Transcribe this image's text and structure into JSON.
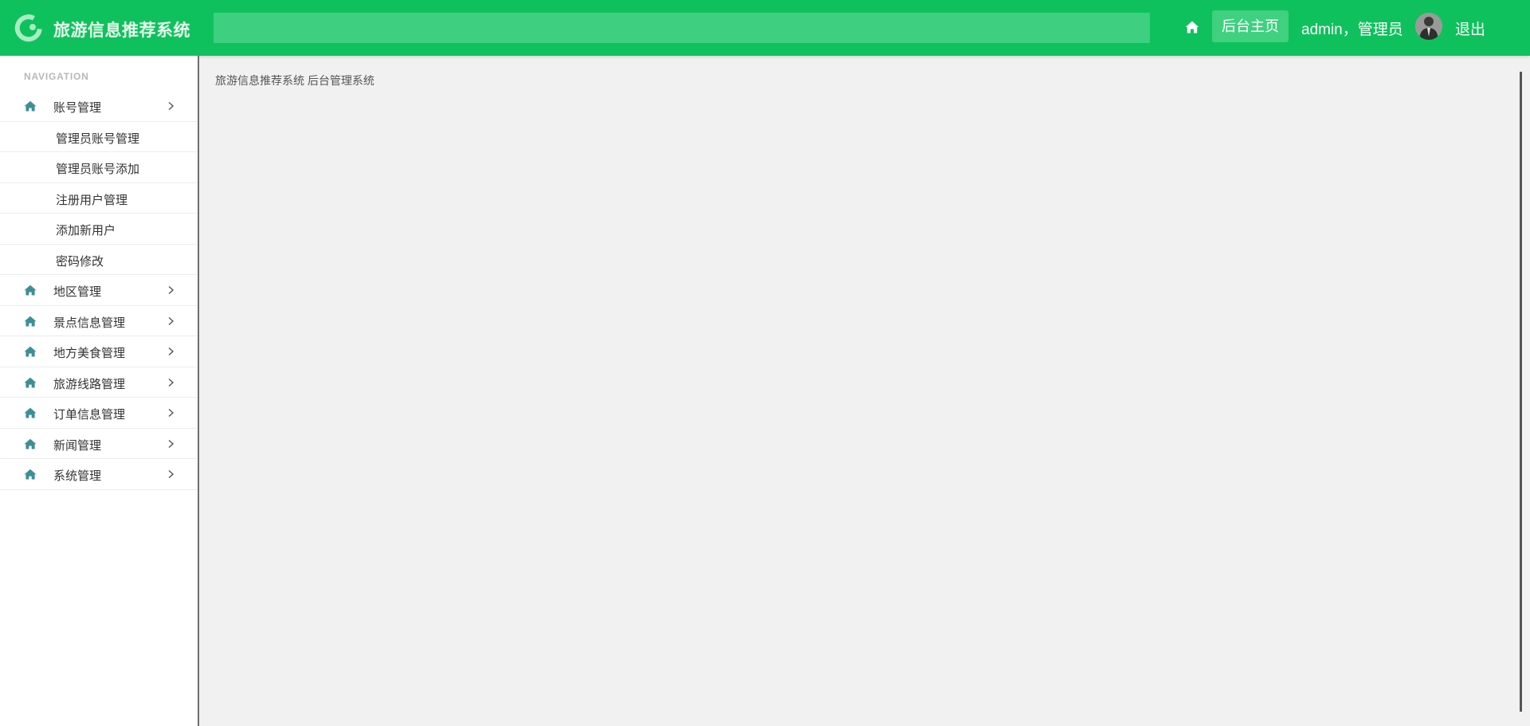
{
  "header": {
    "brand": "旅游信息推荐系统",
    "search": {
      "value": "",
      "placeholder": ""
    },
    "home_icon": "home-icon",
    "dashboard_label": "后台主页",
    "user_label": "admin，管理员",
    "avatar": "user-avatar",
    "logout_label": "退出"
  },
  "sidebar": {
    "heading": "NAVIGATION",
    "menu": [
      {
        "label": "账号管理",
        "icon": "home-icon",
        "expanded": true,
        "children": [
          "管理员账号管理",
          "管理员账号添加",
          "注册用户管理",
          "添加新用户",
          "密码修改"
        ]
      },
      {
        "label": "地区管理",
        "icon": "home-icon"
      },
      {
        "label": "景点信息管理",
        "icon": "home-icon"
      },
      {
        "label": "地方美食管理",
        "icon": "home-icon"
      },
      {
        "label": "旅游线路管理",
        "icon": "home-icon"
      },
      {
        "label": "订单信息管理",
        "icon": "home-icon"
      },
      {
        "label": "新闻管理",
        "icon": "home-icon"
      },
      {
        "label": "系统管理",
        "icon": "home-icon"
      }
    ]
  },
  "main": {
    "breadcrumb": "旅游信息推荐系统 后台管理系统"
  },
  "colors": {
    "header_bg": "#0fc15c",
    "search_bg": "#3ecf80",
    "icon_color": "#3d8f97",
    "content_bg": "#f1f1f1"
  }
}
